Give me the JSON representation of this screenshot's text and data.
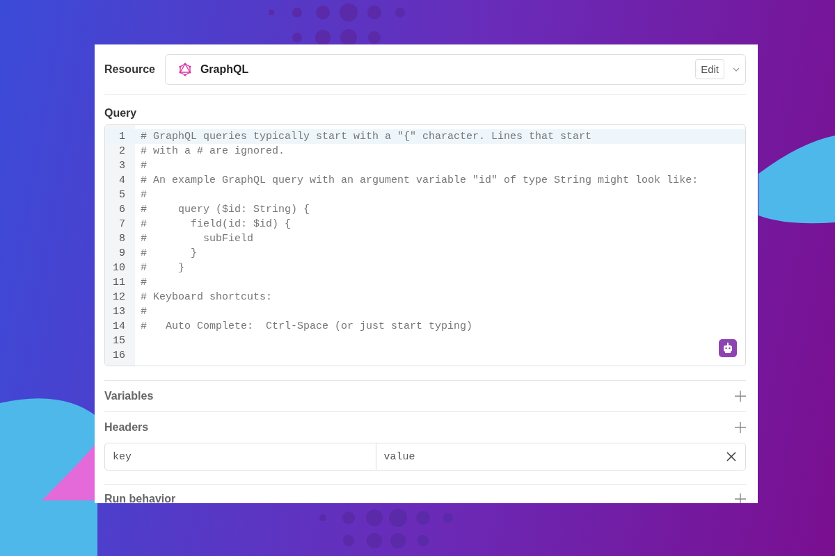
{
  "resource": {
    "label": "Resource",
    "value": "GraphQL",
    "edit_button": "Edit"
  },
  "query": {
    "label": "Query",
    "lines": [
      {
        "number": "1",
        "text": "# GraphQL queries typically start with a \"{\" character. Lines that start",
        "current": true
      },
      {
        "number": "2",
        "text": "# with a # are ignored.",
        "current": false
      },
      {
        "number": "3",
        "text": "#",
        "current": false
      },
      {
        "number": "4",
        "text": "# An example GraphQL query with an argument variable \"id\" of type String might look like:",
        "current": false
      },
      {
        "number": "5",
        "text": "#",
        "current": false
      },
      {
        "number": "6",
        "text": "#     query ($id: String) {",
        "current": false
      },
      {
        "number": "7",
        "text": "#       field(id: $id) {",
        "current": false
      },
      {
        "number": "8",
        "text": "#         subField",
        "current": false
      },
      {
        "number": "9",
        "text": "#       }",
        "current": false
      },
      {
        "number": "10",
        "text": "#     }",
        "current": false
      },
      {
        "number": "11",
        "text": "#",
        "current": false
      },
      {
        "number": "12",
        "text": "# Keyboard shortcuts:",
        "current": false
      },
      {
        "number": "13",
        "text": "#",
        "current": false
      },
      {
        "number": "14",
        "text": "#   Auto Complete:  Ctrl-Space (or just start typing)",
        "current": false
      },
      {
        "number": "15",
        "current": false
      },
      {
        "number": "16",
        "current": false
      }
    ]
  },
  "sections": [
    {
      "label": "Variables"
    },
    {
      "label": "Headers",
      "fields": {
        "key_placeholder": "key",
        "value_placeholder": "value"
      }
    },
    {
      "label": "Run behavior"
    }
  ]
}
